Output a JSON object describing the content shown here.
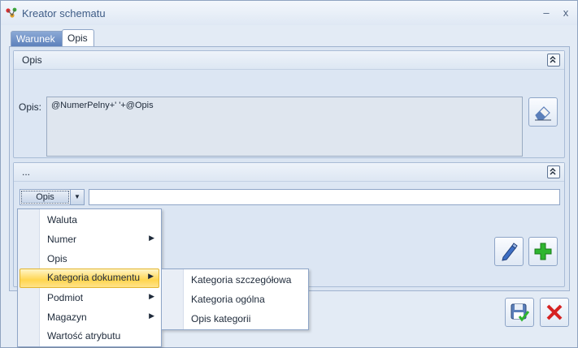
{
  "window": {
    "title": "Kreator schematu",
    "minimize_label": "–",
    "close_label": "x"
  },
  "tabs": [
    {
      "label": "Warunek",
      "active": false
    },
    {
      "label": "Opis",
      "active": true
    }
  ],
  "opis_group": {
    "title": "Opis",
    "field_label": "Opis:",
    "field_value": "@NumerPelny+' '+@Opis",
    "collapse_icon": "double-chevron-up-icon",
    "edit_icon": "eraser-icon"
  },
  "second_group": {
    "title": "...",
    "combo_value": "Opis",
    "text_value": "",
    "add_icon": "plus-icon",
    "pen_icon": "pen-icon"
  },
  "context_menu": {
    "items": [
      {
        "label": "Waluta",
        "has_submenu": false
      },
      {
        "label": "Numer",
        "has_submenu": true
      },
      {
        "label": "Opis",
        "has_submenu": false
      },
      {
        "label": "Kategoria dokumentu",
        "has_submenu": true,
        "highlighted": true
      },
      {
        "label": "Podmiot",
        "has_submenu": true
      },
      {
        "label": "Magazyn",
        "has_submenu": true
      },
      {
        "label": "Wartość atrybutu",
        "has_submenu": false
      }
    ]
  },
  "submenu": {
    "items": [
      {
        "label": "Kategoria szczegółowa"
      },
      {
        "label": "Kategoria ogólna"
      },
      {
        "label": "Opis kategorii"
      }
    ]
  },
  "footer": {
    "save_icon": "save-icon",
    "cancel_icon": "cancel-icon"
  },
  "colors": {
    "accent": "#5b7fba",
    "highlight": "#ffd54f",
    "add_green": "#2fb52f",
    "cancel_red": "#d62222"
  }
}
